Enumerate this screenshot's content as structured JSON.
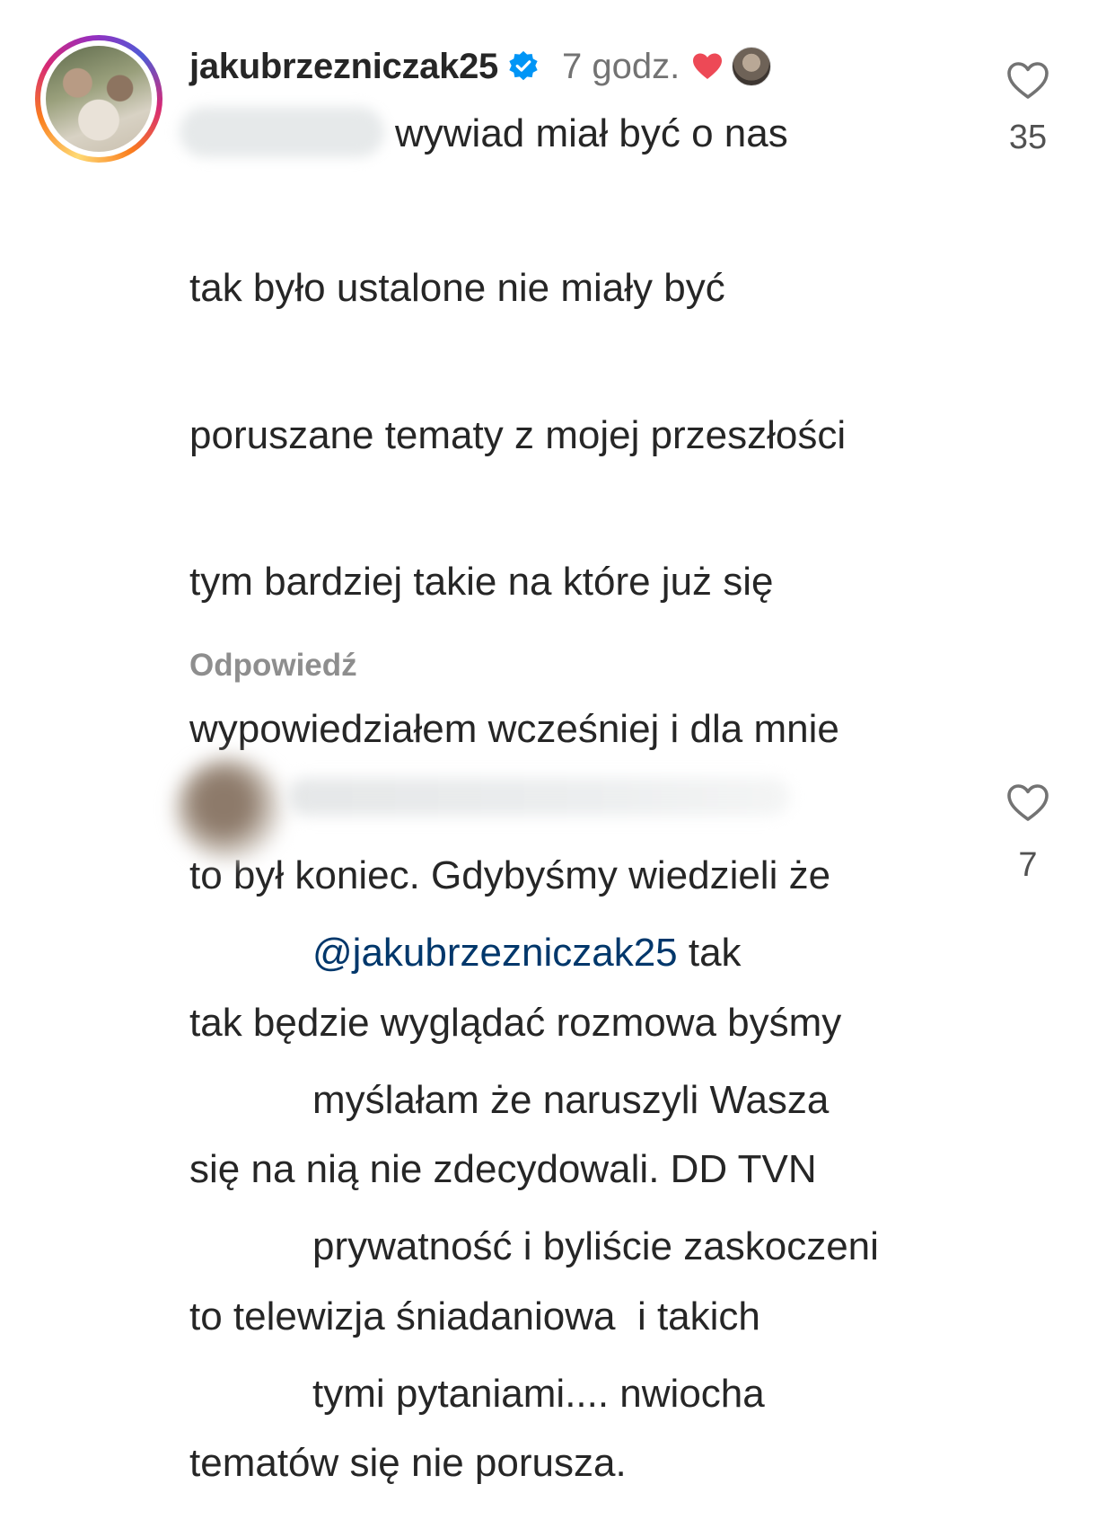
{
  "comment1": {
    "username": "jakubrzezniczak25",
    "verified_icon": "verified-badge-icon",
    "time": "7 godz.",
    "liked_by_author_icon": "red-heart-icon",
    "first_line": "wywiad miał być o nas",
    "body_lines": [
      "tak było ustalone nie miały być",
      "poruszane tematy z mojej przeszłości",
      "tym bardziej takie na które już się",
      "wypowiedziałem wcześniej i dla mnie",
      "to był koniec. Gdybyśmy wiedzieli że",
      "tak będzie wyglądać rozmowa byśmy",
      "się na nią nie zdecydowali. DD TVN",
      "to telewizja śniadaniowa  i takich",
      "tematów się nie porusza."
    ],
    "reply_label": "Odpowiedź",
    "like_count": "35"
  },
  "comment2": {
    "mention": "@jakubrzezniczak25",
    "first_line_rest": " tak",
    "body_lines": [
      "myślałam że naruszyli Wasza",
      "prywatność i byliście zaskoczeni",
      "tymi pytaniami.... nwiocha"
    ],
    "like_count": "7"
  },
  "colors": {
    "text": "#262626",
    "secondary": "#737373",
    "verified_blue": "#0095f6",
    "like_red": "#ed4956",
    "mention": "#00376b"
  }
}
